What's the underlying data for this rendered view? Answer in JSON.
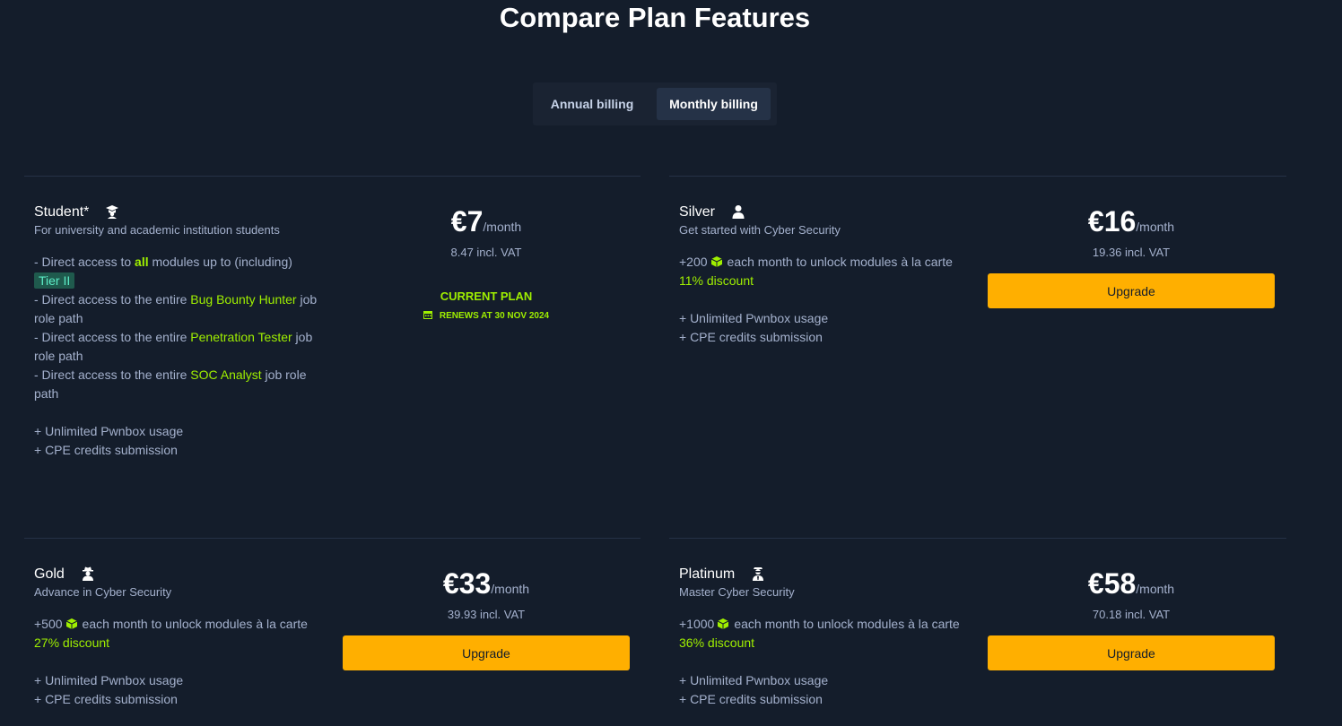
{
  "page": {
    "title": "Compare Plan Features"
  },
  "billing": {
    "annual": "Annual billing",
    "monthly": "Monthly billing",
    "selected": "monthly"
  },
  "plans": {
    "student": {
      "name": "Student*",
      "icon": "student-graduation-cap-icon",
      "tagline": "For university and academic institution students",
      "features": {
        "f1_a": "- Direct access to ",
        "f1_b": "all",
        "f1_c": " modules up to (including)",
        "f1_tier": "Tier II",
        "f2_a": "- Direct access to the entire ",
        "f2_link": "Bug Bounty Hunter",
        "f2_b": " job role path",
        "f3_a": "- Direct access to the entire ",
        "f3_link": "Penetration Tester",
        "f3_b": " job role path",
        "f4_a": "- Direct access to the entire ",
        "f4_link": "SOC Analyst",
        "f4_b": " job role path",
        "pwnbox": "+ Unlimited Pwnbox usage",
        "cpe": "+ CPE credits submission"
      },
      "price": "€7",
      "per": "/month",
      "vat": "8.47 incl. VAT",
      "current": "CURRENT PLAN",
      "renews": "RENEWS AT 30 NOV 2024"
    },
    "silver": {
      "name": "Silver",
      "icon": "user-icon",
      "tagline": "Get started with Cyber Security",
      "cubes": "+200",
      "cubes_text": "each month to unlock modules à la carte",
      "discount": "11% discount",
      "pwnbox": "+ Unlimited Pwnbox usage",
      "cpe": "+ CPE credits submission",
      "price": "€16",
      "per": "/month",
      "vat": "19.36 incl. VAT",
      "button": "Upgrade"
    },
    "gold": {
      "name": "Gold",
      "icon": "hacker-spy-icon",
      "tagline": "Advance in Cyber Security",
      "cubes": "+500",
      "cubes_text": "each month to unlock modules à la carte",
      "discount": "27% discount",
      "pwnbox": "+ Unlimited Pwnbox usage",
      "cpe": "+ CPE credits submission",
      "price": "€33",
      "per": "/month",
      "vat": "39.93 incl. VAT",
      "button": "Upgrade"
    },
    "platinum": {
      "name": "Platinum",
      "icon": "expert-user-icon",
      "tagline": "Master Cyber Security",
      "cubes": "+1000",
      "cubes_text": "each month to unlock modules à la carte",
      "discount": "36% discount",
      "pwnbox": "+ Unlimited Pwnbox usage",
      "cpe": "+ CPE credits submission",
      "price": "€58",
      "per": "/month",
      "vat": "70.18 incl. VAT",
      "button": "Upgrade"
    }
  },
  "colors": {
    "background": "#141d2b",
    "accent_green": "#9fef00",
    "upgrade_button": "#ffaf00",
    "tier_badge": "#1f5a4d"
  }
}
